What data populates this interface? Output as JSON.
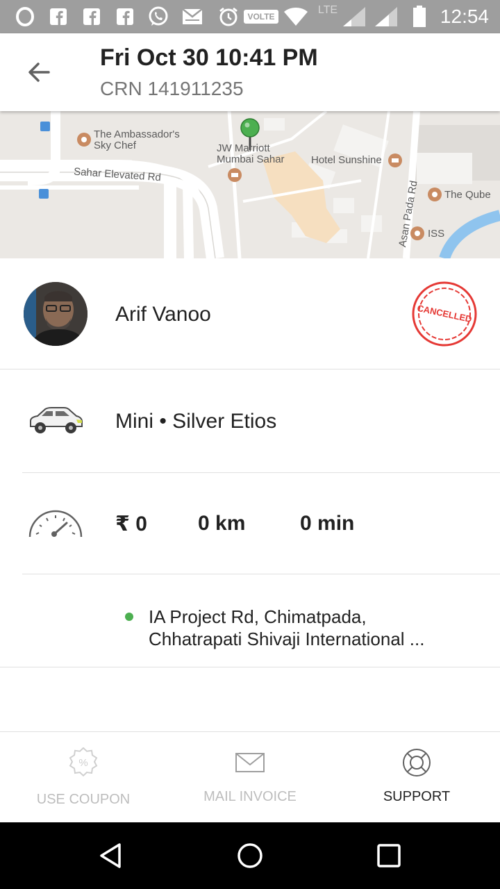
{
  "status_bar": {
    "time": "12:54",
    "volte": "VOLTE",
    "network": "LTE",
    "icons": [
      "opera-icon",
      "facebook-icon",
      "facebook-icon",
      "facebook-icon",
      "whatsapp-icon",
      "mail-icon",
      "alarm-icon",
      "volte-icon",
      "wifi-icon",
      "signal-icon",
      "signal-icon",
      "battery-icon"
    ]
  },
  "header": {
    "title": "Fri Oct 30 10:41 PM",
    "subtitle": "CRN 141911235"
  },
  "map": {
    "labels": {
      "ambassador_1": "The Ambassador's",
      "ambassador_2": "Sky Chef",
      "jw_1": "JW Marriott",
      "jw_2": "Mumbai Sahar",
      "hotel": "Hotel Sunshine",
      "sahar_road": "Sahar Elevated Rd",
      "asan_pada": "Asan Pada Rd",
      "qube": "The Qube",
      "iss": "ISS"
    },
    "pin_color": "#4caf50"
  },
  "driver": {
    "name": "Arif Vanoo",
    "status_stamp": "CANCELLED",
    "stamp_color": "#e53935"
  },
  "car": {
    "description": "Mini • Silver Etios"
  },
  "trip": {
    "fare": "₹ 0",
    "distance": "0 km",
    "duration": "0 min"
  },
  "pickup": {
    "line1": "IA Project Rd, Chimatpada,",
    "line2": "Chhatrapati Shivaji International ..."
  },
  "actions": {
    "coupon": "USE COUPON",
    "invoice": "MAIL INVOICE",
    "support": "SUPPORT"
  },
  "nav": {
    "back": "back-icon",
    "home": "home-icon",
    "recents": "recents-icon"
  }
}
